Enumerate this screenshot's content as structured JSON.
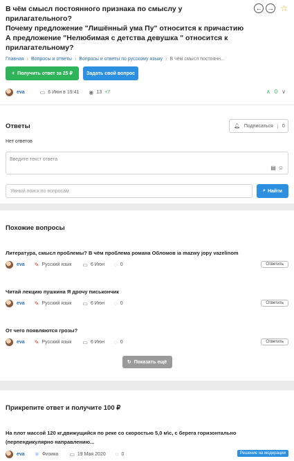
{
  "question": {
    "title_lines": [
      "В чём смысл постоянного признака по смыслу у прилагательного?",
      "Почему предложение \"Лишённый ума Пу\" относится к причастию",
      "А предложение \"Нелюбимая с детства девушка \" относится к",
      "прилагательному?"
    ],
    "prev_icon": "←",
    "next_icon": "→",
    "star_icon": "☆",
    "breadcrumbs": [
      "Главная",
      "Вопросы и ответы",
      "Вопросы и ответы по русскому языку",
      "В чём смысл постоянн..."
    ],
    "breadcrumb_sep": "›",
    "get_answer_button": "Получить ответ за 25 ₽",
    "get_answer_icon": "+",
    "ask_button": "Задать свой вопрос",
    "author": "eva",
    "date": "6 Июн в 19:41",
    "views": "13",
    "views_delta": "+7",
    "vote_up_icon": "∧",
    "vote_count": "0",
    "vote_down_icon": "∨"
  },
  "answers": {
    "title": "Ответы",
    "subscribe_label": "Подписаться",
    "subscribe_count": "0",
    "empty_text": "Нет ответов",
    "input_placeholder": "Введите текст ответа"
  },
  "search": {
    "placeholder": "Умный поиск по вопросам",
    "button": "Найти"
  },
  "similar": {
    "title": "Похожие вопросы",
    "items": [
      {
        "question": "Литература, смысл проблемы? В чём проблема романа Обломов ia mazwy jopy vazelinom",
        "author": "eva",
        "subject": "Русский язык",
        "date": "6 Июн",
        "comments": "0",
        "reply": "Ответить"
      },
      {
        "question": "Читай лекцию пушкина Я дрочу писькончик",
        "author": "eva",
        "subject": "Русский язык",
        "date": "6 Июн",
        "comments": "0",
        "reply": "Ответить"
      },
      {
        "question": "От чего появляются грозы?",
        "author": "eva",
        "subject": "Русский язык",
        "date": "6 Июн",
        "comments": "0",
        "reply": "Ответить"
      }
    ],
    "more_button": "Показать ещё"
  },
  "pin": {
    "title": "Прикрепите ответ и получите 100 ₽",
    "question_lines": [
      "На плот массой 120 кг,движущийся по реке со скоростью 5,0 м\\с, с берега горизонтально",
      "(перпендикулярно направлению..."
    ],
    "author": "eva",
    "subject": "Физика",
    "date": "19 Мая 2020",
    "comments": "0",
    "badge": "Решение на модерации"
  },
  "colors": {
    "green": "#2fb45a",
    "blue": "#2d8fe0",
    "link": "#2a6db0",
    "star": "#e0b21a"
  }
}
